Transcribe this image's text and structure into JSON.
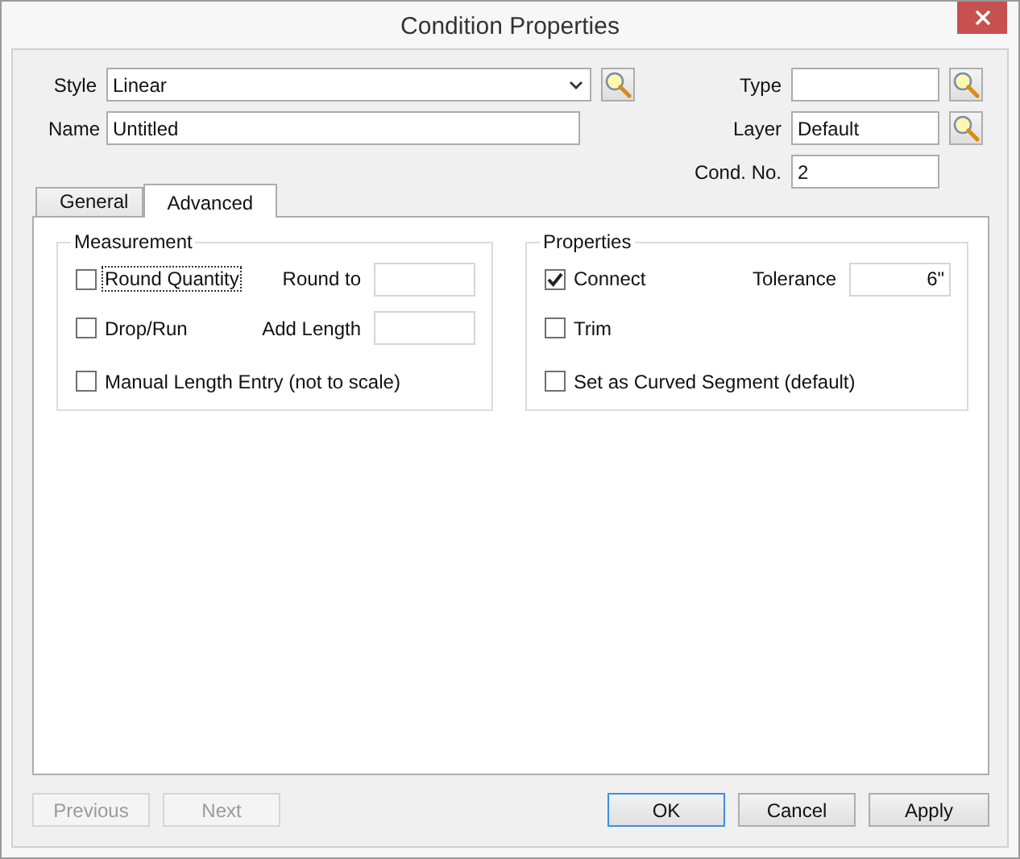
{
  "window": {
    "title": "Condition Properties"
  },
  "header": {
    "style": {
      "label": "Style",
      "value": "Linear"
    },
    "name": {
      "label": "Name",
      "value": "Untitled"
    },
    "type": {
      "label": "Type"
    },
    "layer": {
      "label": "Layer",
      "value": "Default"
    },
    "cond_no": {
      "label": "Cond. No.",
      "value": "2"
    }
  },
  "tabs": [
    {
      "label": "General",
      "selected": false
    },
    {
      "label": "Advanced",
      "selected": true
    }
  ],
  "groups": [
    {
      "title": "Measurement",
      "rows": [
        {
          "option": {
            "label": "Round Quantity",
            "checked": false,
            "focused": true
          },
          "field": {
            "label": "Round to"
          }
        },
        {
          "option": {
            "label": "Drop/Run",
            "checked": false,
            "focused": false
          },
          "field": {
            "label": "Add Length"
          }
        },
        {
          "option": {
            "label": "Manual Length Entry (not to scale)",
            "checked": false,
            "focused": false
          }
        }
      ]
    },
    {
      "title": "Properties",
      "rows": [
        {
          "option": {
            "label": "Connect",
            "checked": true,
            "focused": false
          },
          "field": {
            "label": "Tolerance",
            "value": "6\""
          }
        },
        {
          "option": {
            "label": "Trim",
            "checked": false,
            "focused": false
          }
        },
        {
          "option": {
            "label": "Set as Curved Segment (default)",
            "checked": false,
            "focused": false
          }
        }
      ]
    }
  ],
  "nav_buttons": [
    {
      "label": "Previous",
      "disabled": true
    },
    {
      "label": "Next",
      "disabled": true
    }
  ],
  "action_buttons": [
    {
      "label": "OK",
      "default": true
    },
    {
      "label": "Cancel",
      "default": false
    },
    {
      "label": "Apply",
      "default": false
    }
  ]
}
